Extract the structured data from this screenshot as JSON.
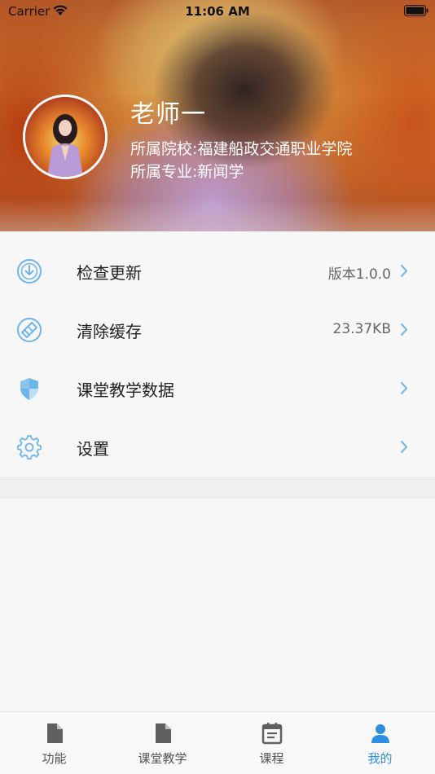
{
  "status_bar": {
    "carrier": "Carrier",
    "time": "11:06 AM"
  },
  "profile": {
    "name": "老师一",
    "school": "所属院校:福建船政交通职业学院",
    "major": "所属专业:新闻学"
  },
  "menu": {
    "items": [
      {
        "label": "检查更新",
        "value": "版本1.0.0",
        "icon": "download-circle-icon"
      },
      {
        "label": "清除缓存",
        "value": "23.37KB",
        "icon": "broom-icon"
      },
      {
        "label": "课堂教学数据",
        "value": "",
        "icon": "shield-icon"
      },
      {
        "label": "设置",
        "value": "",
        "icon": "gear-icon"
      }
    ]
  },
  "tab_bar": {
    "tabs": [
      {
        "label": "功能",
        "icon": "document-icon",
        "active": false
      },
      {
        "label": "课堂教学",
        "icon": "document-icon",
        "active": false
      },
      {
        "label": "课程",
        "icon": "calendar-icon",
        "active": false
      },
      {
        "label": "我的",
        "icon": "person-icon",
        "active": true
      }
    ]
  },
  "colors": {
    "accent": "#2e8fe0",
    "icon_blue": "#6fb5ea",
    "chevron": "#7ab8e8"
  }
}
